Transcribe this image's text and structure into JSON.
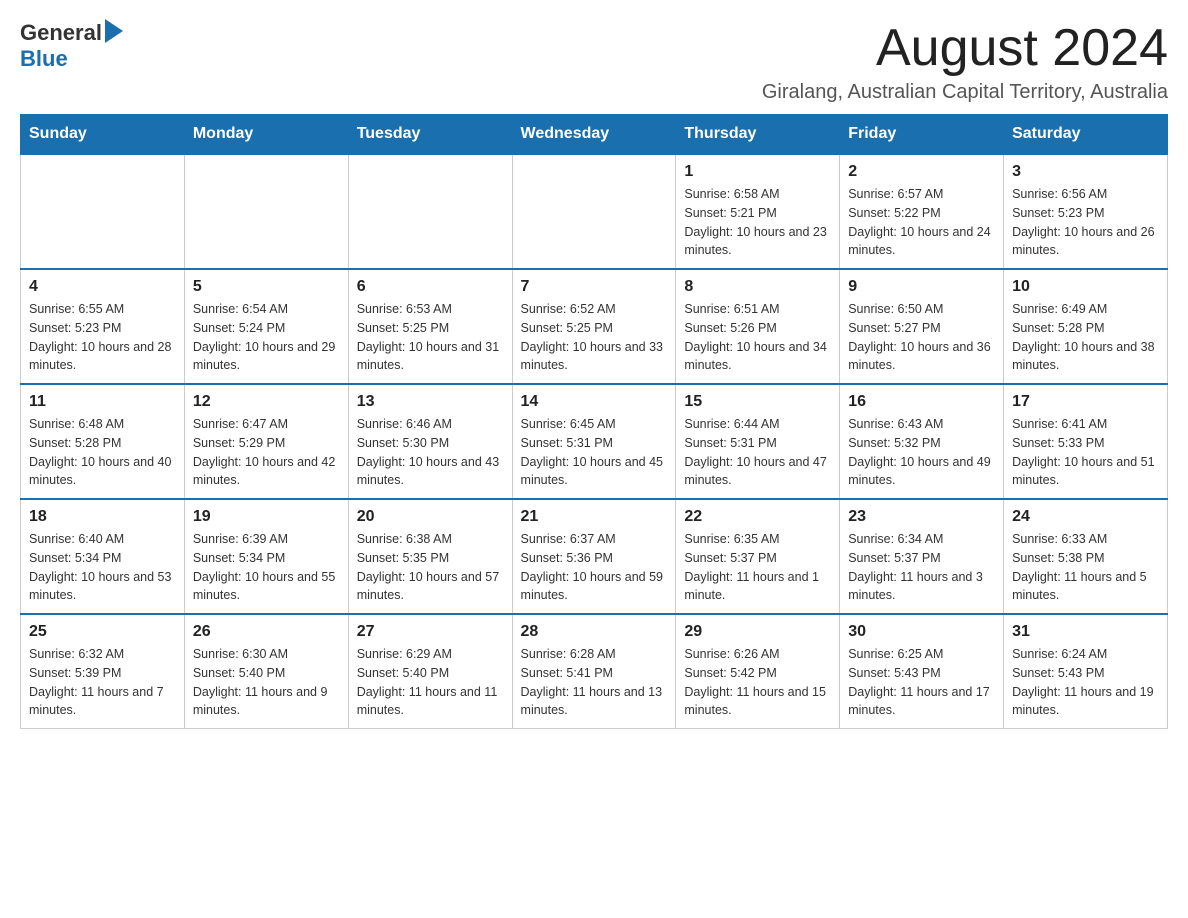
{
  "header": {
    "logo": {
      "general": "General",
      "blue": "Blue"
    },
    "month_title": "August 2024",
    "location": "Giralang, Australian Capital Territory, Australia"
  },
  "calendar": {
    "days_of_week": [
      "Sunday",
      "Monday",
      "Tuesday",
      "Wednesday",
      "Thursday",
      "Friday",
      "Saturday"
    ],
    "weeks": [
      [
        {
          "day": "",
          "info": ""
        },
        {
          "day": "",
          "info": ""
        },
        {
          "day": "",
          "info": ""
        },
        {
          "day": "",
          "info": ""
        },
        {
          "day": "1",
          "info": "Sunrise: 6:58 AM\nSunset: 5:21 PM\nDaylight: 10 hours and 23 minutes."
        },
        {
          "day": "2",
          "info": "Sunrise: 6:57 AM\nSunset: 5:22 PM\nDaylight: 10 hours and 24 minutes."
        },
        {
          "day": "3",
          "info": "Sunrise: 6:56 AM\nSunset: 5:23 PM\nDaylight: 10 hours and 26 minutes."
        }
      ],
      [
        {
          "day": "4",
          "info": "Sunrise: 6:55 AM\nSunset: 5:23 PM\nDaylight: 10 hours and 28 minutes."
        },
        {
          "day": "5",
          "info": "Sunrise: 6:54 AM\nSunset: 5:24 PM\nDaylight: 10 hours and 29 minutes."
        },
        {
          "day": "6",
          "info": "Sunrise: 6:53 AM\nSunset: 5:25 PM\nDaylight: 10 hours and 31 minutes."
        },
        {
          "day": "7",
          "info": "Sunrise: 6:52 AM\nSunset: 5:25 PM\nDaylight: 10 hours and 33 minutes."
        },
        {
          "day": "8",
          "info": "Sunrise: 6:51 AM\nSunset: 5:26 PM\nDaylight: 10 hours and 34 minutes."
        },
        {
          "day": "9",
          "info": "Sunrise: 6:50 AM\nSunset: 5:27 PM\nDaylight: 10 hours and 36 minutes."
        },
        {
          "day": "10",
          "info": "Sunrise: 6:49 AM\nSunset: 5:28 PM\nDaylight: 10 hours and 38 minutes."
        }
      ],
      [
        {
          "day": "11",
          "info": "Sunrise: 6:48 AM\nSunset: 5:28 PM\nDaylight: 10 hours and 40 minutes."
        },
        {
          "day": "12",
          "info": "Sunrise: 6:47 AM\nSunset: 5:29 PM\nDaylight: 10 hours and 42 minutes."
        },
        {
          "day": "13",
          "info": "Sunrise: 6:46 AM\nSunset: 5:30 PM\nDaylight: 10 hours and 43 minutes."
        },
        {
          "day": "14",
          "info": "Sunrise: 6:45 AM\nSunset: 5:31 PM\nDaylight: 10 hours and 45 minutes."
        },
        {
          "day": "15",
          "info": "Sunrise: 6:44 AM\nSunset: 5:31 PM\nDaylight: 10 hours and 47 minutes."
        },
        {
          "day": "16",
          "info": "Sunrise: 6:43 AM\nSunset: 5:32 PM\nDaylight: 10 hours and 49 minutes."
        },
        {
          "day": "17",
          "info": "Sunrise: 6:41 AM\nSunset: 5:33 PM\nDaylight: 10 hours and 51 minutes."
        }
      ],
      [
        {
          "day": "18",
          "info": "Sunrise: 6:40 AM\nSunset: 5:34 PM\nDaylight: 10 hours and 53 minutes."
        },
        {
          "day": "19",
          "info": "Sunrise: 6:39 AM\nSunset: 5:34 PM\nDaylight: 10 hours and 55 minutes."
        },
        {
          "day": "20",
          "info": "Sunrise: 6:38 AM\nSunset: 5:35 PM\nDaylight: 10 hours and 57 minutes."
        },
        {
          "day": "21",
          "info": "Sunrise: 6:37 AM\nSunset: 5:36 PM\nDaylight: 10 hours and 59 minutes."
        },
        {
          "day": "22",
          "info": "Sunrise: 6:35 AM\nSunset: 5:37 PM\nDaylight: 11 hours and 1 minute."
        },
        {
          "day": "23",
          "info": "Sunrise: 6:34 AM\nSunset: 5:37 PM\nDaylight: 11 hours and 3 minutes."
        },
        {
          "day": "24",
          "info": "Sunrise: 6:33 AM\nSunset: 5:38 PM\nDaylight: 11 hours and 5 minutes."
        }
      ],
      [
        {
          "day": "25",
          "info": "Sunrise: 6:32 AM\nSunset: 5:39 PM\nDaylight: 11 hours and 7 minutes."
        },
        {
          "day": "26",
          "info": "Sunrise: 6:30 AM\nSunset: 5:40 PM\nDaylight: 11 hours and 9 minutes."
        },
        {
          "day": "27",
          "info": "Sunrise: 6:29 AM\nSunset: 5:40 PM\nDaylight: 11 hours and 11 minutes."
        },
        {
          "day": "28",
          "info": "Sunrise: 6:28 AM\nSunset: 5:41 PM\nDaylight: 11 hours and 13 minutes."
        },
        {
          "day": "29",
          "info": "Sunrise: 6:26 AM\nSunset: 5:42 PM\nDaylight: 11 hours and 15 minutes."
        },
        {
          "day": "30",
          "info": "Sunrise: 6:25 AM\nSunset: 5:43 PM\nDaylight: 11 hours and 17 minutes."
        },
        {
          "day": "31",
          "info": "Sunrise: 6:24 AM\nSunset: 5:43 PM\nDaylight: 11 hours and 19 minutes."
        }
      ]
    ]
  }
}
